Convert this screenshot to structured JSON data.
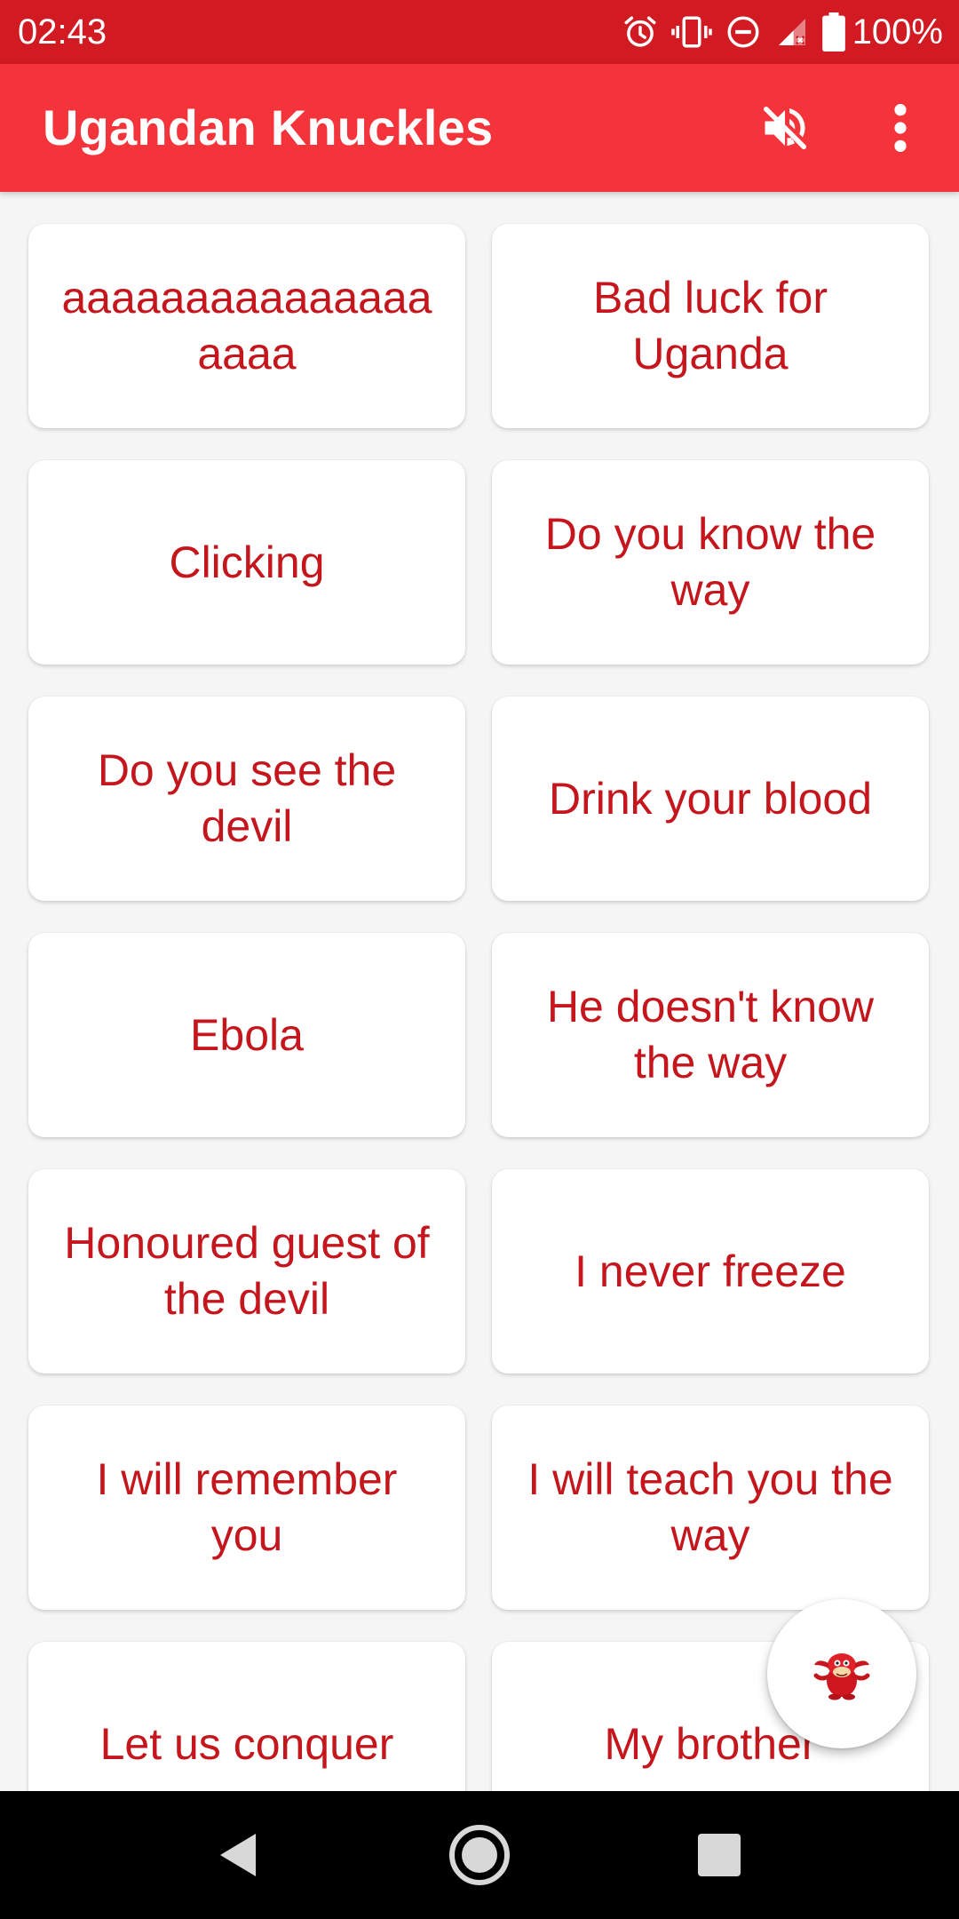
{
  "status_bar": {
    "time": "02:43",
    "battery": "100%",
    "icons": [
      "alarm-icon",
      "vibrate-icon",
      "do-not-disturb-icon",
      "signal-icon",
      "battery-icon"
    ]
  },
  "app_bar": {
    "title": "Ugandan Knuckles",
    "actions": [
      "mute-icon",
      "overflow-menu-icon"
    ]
  },
  "colors": {
    "status_bar": "#d11a22",
    "app_bar": "#f5333b",
    "card_text": "#c4161c",
    "background": "#f5f5f5"
  },
  "sounds": [
    {
      "label": "aaaaaaaaaaaaaaaaaaa"
    },
    {
      "label": "Bad luck for Uganda"
    },
    {
      "label": "Clicking"
    },
    {
      "label": "Do you know the way"
    },
    {
      "label": "Do you see the devil"
    },
    {
      "label": "Drink your blood"
    },
    {
      "label": "Ebola"
    },
    {
      "label": "He doesn't know the way"
    },
    {
      "label": "Honoured guest of the devil"
    },
    {
      "label": "I never freeze"
    },
    {
      "label": "I will remember you"
    },
    {
      "label": "I will teach you the way"
    },
    {
      "label": "Let us conquer"
    },
    {
      "label": "My brother"
    }
  ],
  "fab": {
    "icon": "knuckles-icon"
  },
  "nav_bar": {
    "buttons": [
      "back-icon",
      "home-icon",
      "recents-icon"
    ]
  }
}
